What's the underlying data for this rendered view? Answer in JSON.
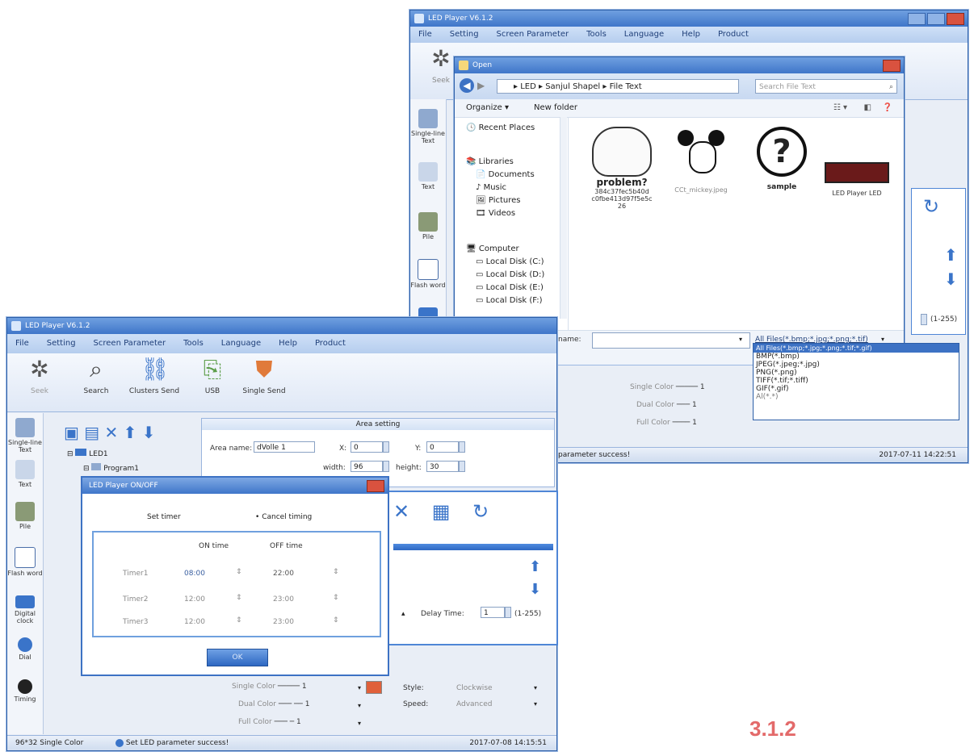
{
  "back_window": {
    "title": "LED Player V6.1.2",
    "menu": [
      "File",
      "Setting",
      "Screen Parameter",
      "Tools",
      "Language",
      "Help",
      "Product"
    ],
    "ribbon_label": "Seek",
    "sidebar": [
      "Single-line Text",
      "Text",
      "Pile",
      "Flash word"
    ],
    "right_side": {
      "range": "(1-255)"
    },
    "bottom": {
      "single_color": "Single Color",
      "dual_color": "Dual Color",
      "full_color": "Full Color",
      "sep": "1"
    },
    "status": {
      "message": "parameter success!",
      "timestamp": "2017-07-11 14:22:51"
    },
    "open_dialog": {
      "title": "Open",
      "path": [
        "LED",
        "Sanjul Shapel",
        "File Text"
      ],
      "search_placeholder": "Search File Text",
      "organize": "Organize",
      "new_folder": "New folder",
      "nav": {
        "recent": "Recent Places",
        "libraries": "Libraries",
        "documents": "Documents",
        "music": "Music",
        "pictures": "Pictures",
        "videos": "Videos",
        "computer": "Computer",
        "disk_c": "Local Disk (C:)",
        "disk_d": "Local Disk (D:)",
        "disk_e": "Local Disk (E:)",
        "disk_f": "Local Disk (F:)"
      },
      "files": [
        {
          "image_text": "problem?",
          "name": "384c37fec5b40d c0fbe413d97f5e5c 26"
        },
        {
          "image_text": "",
          "name": "CCt_mickey.jpeg"
        },
        {
          "image_text": "?",
          "name": "sample"
        },
        {
          "image_text": "",
          "name": "LED Player LED"
        }
      ],
      "file_name_label": "name:",
      "filter_selected": "All Files(*.bmp;*.jpg;*.png;*.tif)",
      "filter_options": [
        "All Files(*.bmp;*.jpg;*.png;*.tif;*.gif)",
        "BMP(*.bmp)",
        "JPEG(*.jpeg;*.jpg)",
        "PNG(*.png)",
        "TIFF(*.tif;*.tiff)",
        "GIF(*.gif)",
        "Al(*.*)"
      ]
    }
  },
  "front_window": {
    "title": "LED Player V6.1.2",
    "menu": [
      "File",
      "Setting",
      "Screen Parameter",
      "Tools",
      "Language",
      "Help",
      "Product"
    ],
    "ribbon": [
      "Seek",
      "Search",
      "Clusters Send",
      "USB",
      "Single Send"
    ],
    "sidebar": [
      "Single-line Text",
      "Text",
      "Pile",
      "Flash word",
      "Digital clock",
      "Dial",
      "Timing"
    ],
    "tree": {
      "root": "LED1",
      "child": "Program1"
    },
    "area": {
      "header": "Area setting",
      "name_label": "Area name:",
      "name_value": "dVolle 1",
      "x_label": "X:",
      "x_value": "0",
      "y_label": "Y:",
      "y_value": "0",
      "width_label": "width:",
      "width_value": "96",
      "height_label": "height:",
      "height_value": "30"
    },
    "delay_label": "Delay Time:",
    "delay_value": "1",
    "delay_range": "(1-255)",
    "bottom": {
      "single_color": "Single Color",
      "dual_color": "Dual Color",
      "full_color": "Full Color",
      "sep": "1",
      "style_label": "Style:",
      "style_value": "Clockwise",
      "speed_label": "Speed:",
      "speed_value": "Advanced"
    },
    "status": {
      "size": "96*32 Single Color",
      "message": "Set LED parameter success!",
      "timestamp": "2017-07-08 14:15:51"
    }
  },
  "timer_dialog": {
    "title": "LED Player ON/OFF",
    "set_timer": "Set timer",
    "cancel": "Cancel timing",
    "on_header": "ON time",
    "off_header": "OFF time",
    "rows": [
      {
        "label": "Timer1",
        "on": "08:00",
        "off": "22:00"
      },
      {
        "label": "Timer2",
        "on": "12:00",
        "off": "23:00"
      },
      {
        "label": "Timer3",
        "on": "12:00",
        "off": "23:00"
      }
    ],
    "ok": "OK"
  },
  "figure_label": "3.1.2",
  "colors": {
    "accent": "#3d72c4",
    "label": "#e36a6a"
  }
}
